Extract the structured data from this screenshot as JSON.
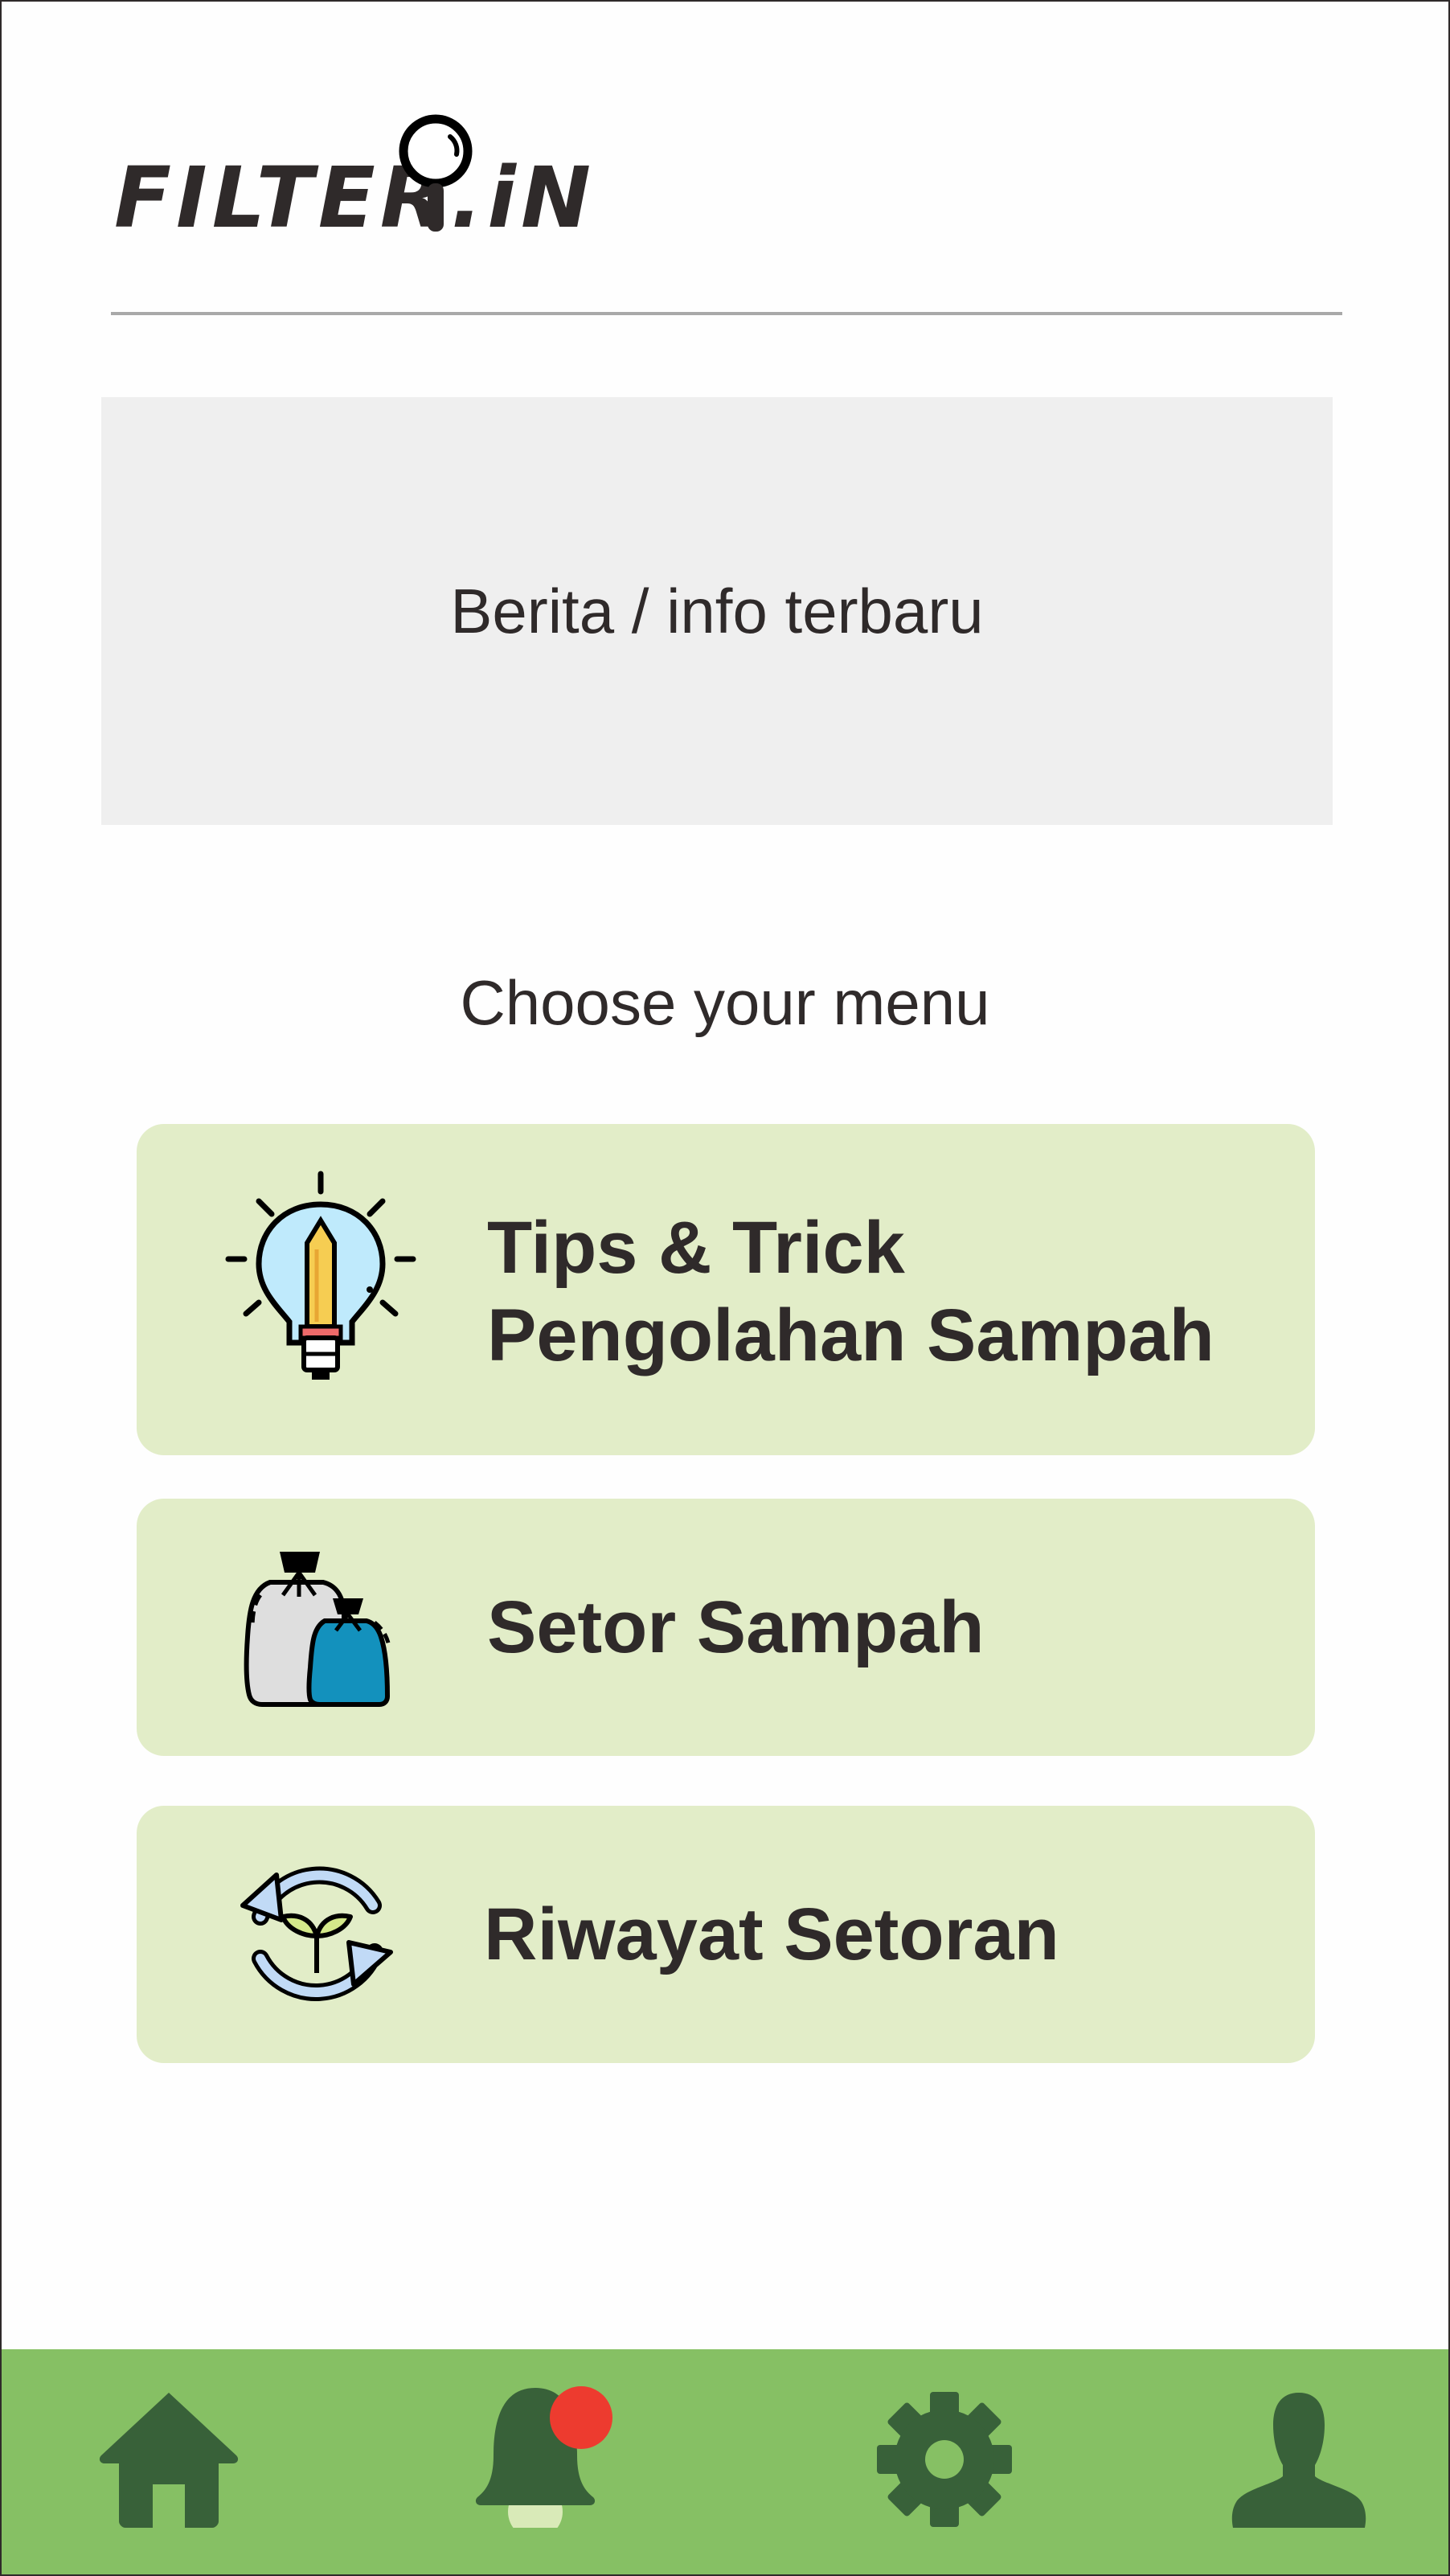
{
  "header": {
    "logo_text": "FILTER.iN",
    "logo_icon": "magnifier-icon"
  },
  "news": {
    "placeholder_text": "Berita / info terbaru"
  },
  "menu": {
    "heading": "Choose your menu",
    "items": [
      {
        "title_line1": "Tips & Trick",
        "title_line2": "Pengolahan Sampah",
        "icon": "lightbulb-pencil-icon"
      },
      {
        "title": "Setor Sampah",
        "icon": "garbage-bags-icon"
      },
      {
        "title": "Riwayat Setoran",
        "icon": "recycle-sprout-icon"
      }
    ]
  },
  "bottom_nav": {
    "items": [
      {
        "name": "home",
        "icon": "home-icon"
      },
      {
        "name": "notifications",
        "icon": "bell-icon",
        "has_badge": true
      },
      {
        "name": "settings",
        "icon": "gear-icon"
      },
      {
        "name": "profile",
        "icon": "user-icon"
      }
    ]
  },
  "colors": {
    "nav_bar": "#86c064",
    "nav_icon": "#386139",
    "card_background": "#e2edc8",
    "news_background": "#efefef",
    "badge": "#ed3b2f",
    "text": "#2f2a2a"
  }
}
